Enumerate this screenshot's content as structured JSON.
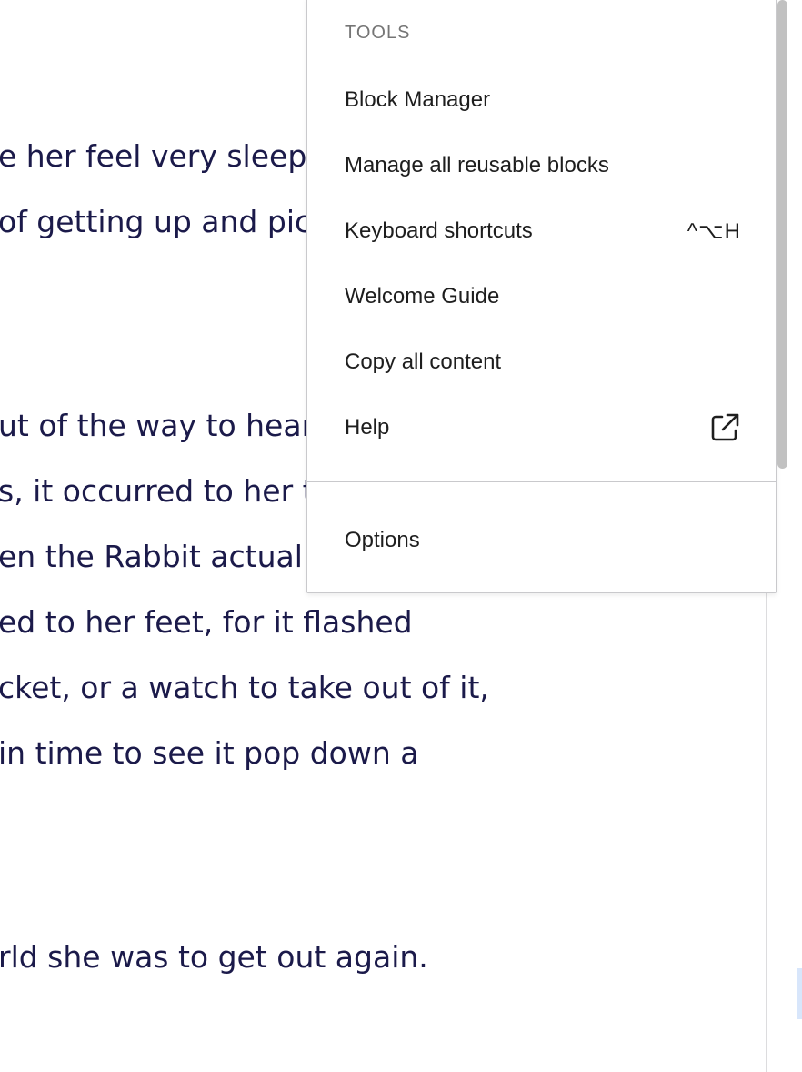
{
  "editor": {
    "lines": [
      "e her feel very sleepy",
      "of getting up and pick",
      "ut of the way to hear",
      "s, it occurred to her th",
      "en the Rabbit actually",
      "ed to her feet, for it flashed",
      "cket, or a watch to take out of it,",
      " in time to see it pop down a",
      "rld she was to get out again."
    ]
  },
  "menu": {
    "group_label": "TOOLS",
    "items": [
      {
        "label": "Block Manager",
        "shortcut": ""
      },
      {
        "label": "Manage all reusable blocks",
        "shortcut": ""
      },
      {
        "label": "Keyboard shortcuts",
        "shortcut": "^⌥H"
      },
      {
        "label": "Welcome Guide",
        "shortcut": ""
      },
      {
        "label": "Copy all content",
        "shortcut": ""
      },
      {
        "label": "Help",
        "icon": "external-link-icon"
      }
    ],
    "options_label": "Options"
  },
  "colors": {
    "text": "#1b1a4a",
    "menu_text": "#1e1e1e",
    "group_label": "#757575",
    "border": "#c9c9cc"
  }
}
